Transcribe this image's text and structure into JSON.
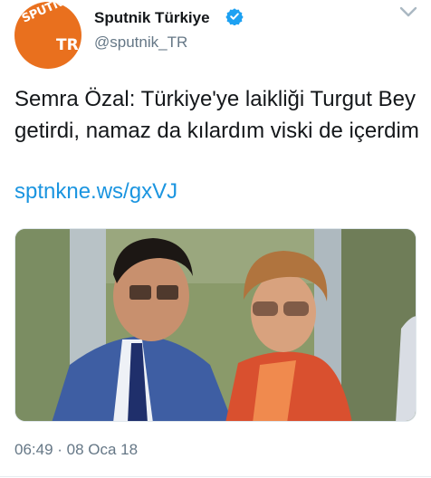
{
  "account": {
    "display_name": "Sputnik Türkiye",
    "handle": "@sputnik_TR",
    "avatar_text_top": "SPUTNIK",
    "avatar_text_bottom": "TR",
    "verified": true,
    "avatar_color": "#e9701e"
  },
  "tweet": {
    "text": "Semra Özal: Türkiye'ye laikliği Turgut Bey getirdi, namaz da kılardım viski de içerdim",
    "link": "sptnkne.ws/gxVJ",
    "timestamp": "06:49 · 08 Oca 18"
  },
  "icons": {
    "verified": "verified-badge-icon",
    "menu": "chevron-down-icon"
  },
  "colors": {
    "link": "#1b95e0",
    "verified": "#1da1f2",
    "secondary_text": "#657786"
  }
}
